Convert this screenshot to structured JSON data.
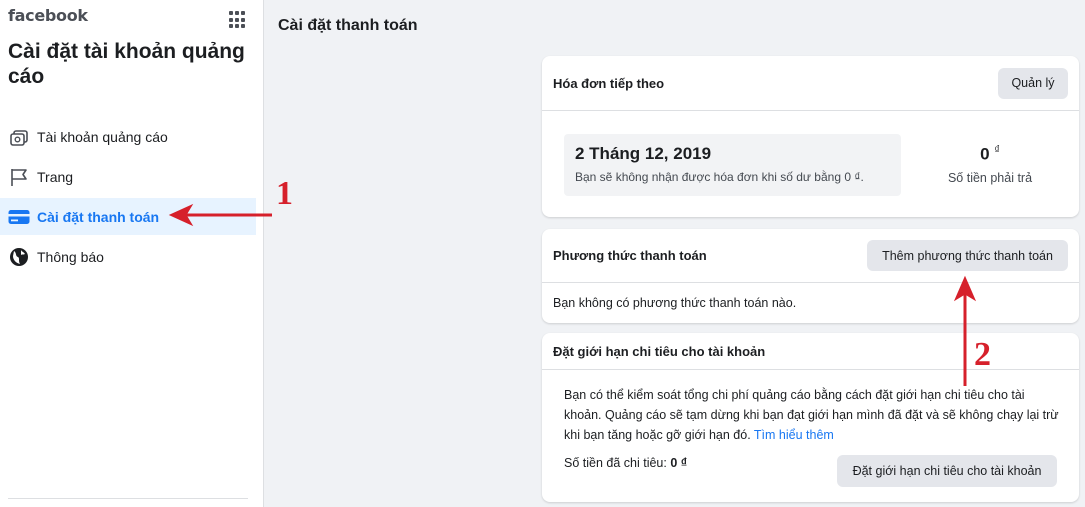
{
  "sidebar": {
    "brand": "facebook",
    "title": "Cài đặt tài khoản quảng cáo",
    "items": [
      {
        "label": "Tài khoản quảng cáo",
        "icon": "ad-account-icon"
      },
      {
        "label": "Trang",
        "icon": "flag-icon"
      },
      {
        "label": "Cài đặt thanh toán",
        "icon": "credit-card-icon",
        "active": true
      },
      {
        "label": "Thông báo",
        "icon": "globe-icon"
      }
    ]
  },
  "main": {
    "title": "Cài đặt thanh toán",
    "next_invoice": {
      "heading": "Hóa đơn tiếp theo",
      "manage_label": "Quản lý",
      "date": "2 Tháng 12, 2019",
      "note": "Bạn sẽ không nhận được hóa đơn khi số dư bằng 0 ₫.",
      "amount": "0",
      "currency": "₫",
      "amount_label": "Số tiền phải trả"
    },
    "payment_methods": {
      "heading": "Phương thức thanh toán",
      "add_label": "Thêm phương thức thanh toán",
      "empty_text": "Bạn không có phương thức thanh toán nào."
    },
    "spending_limit": {
      "heading": "Đặt giới hạn chi tiêu cho tài khoản",
      "description": "Bạn có thể kiểm soát tổng chi phí quảng cáo bằng cách đặt giới hạn chi tiêu cho tài khoản. Quảng cáo sẽ tạm dừng khi bạn đạt giới hạn mình đã đặt và sẽ không chạy lại trừ khi bạn tăng hoặc gỡ giới hạn đó.",
      "learn_more": "Tìm hiểu thêm",
      "spent_label": "Số tiền đã chi tiêu:",
      "spent_value": "0 ₫",
      "set_limit_label": "Đặt giới hạn chi tiêu cho tài khoản"
    }
  },
  "annotations": {
    "one": "1",
    "two": "2",
    "color": "#d6202b"
  },
  "colors": {
    "accent": "#1877f2",
    "active_bg": "#e7f3ff",
    "page_bg": "#f0f2f5"
  }
}
